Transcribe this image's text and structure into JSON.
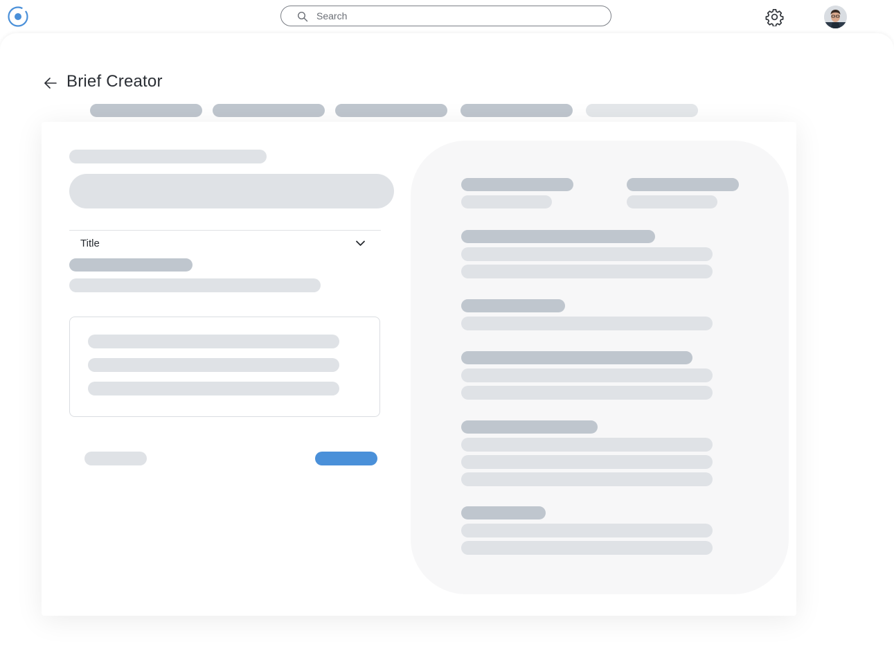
{
  "app": {
    "logo_icon": "ring-dot-logo-icon",
    "accent_color": "#4a90d9"
  },
  "search": {
    "placeholder": "Search",
    "value": "",
    "icon": "search-icon"
  },
  "header": {
    "settings_icon": "gear-icon",
    "avatar": "user-avatar"
  },
  "page": {
    "title": "Brief Creator",
    "back_icon": "arrow-left-icon"
  },
  "form": {
    "section_label": "Title",
    "section_icon": "chevron-down-icon"
  },
  "colors": {
    "skeleton_dark": "#bfc6ce",
    "skeleton_light": "#dfe2e6",
    "primary_button": "#4a90d9",
    "preview_background": "#f7f7f8"
  }
}
